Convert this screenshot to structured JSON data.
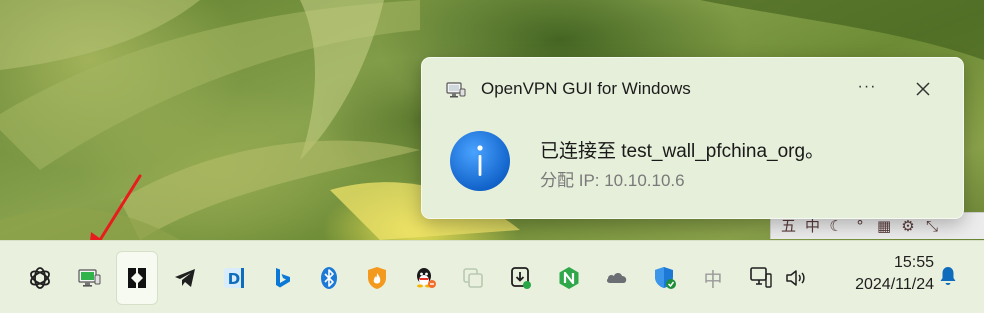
{
  "toast": {
    "app_name": "OpenVPN GUI for Windows",
    "more_label": "···",
    "message": "已连接至 test_wall_pfchina_org。",
    "sub_message": "分配 IP: 10.10.10.6",
    "app_icon": "openvpn-monitor-icon",
    "info_icon": "info-icon",
    "close_icon": "close-icon"
  },
  "ime_toolbar": {
    "items": [
      "五",
      "中",
      "☾",
      "°",
      "▦",
      "⚙",
      "⤡"
    ]
  },
  "taskbar": {
    "icons": [
      {
        "name": "chatgpt-icon"
      },
      {
        "name": "openvpn-tray-icon"
      },
      {
        "name": "app-b-icon",
        "active": true
      },
      {
        "name": "telegram-icon"
      },
      {
        "name": "dictionary-d-icon"
      },
      {
        "name": "bing-icon"
      },
      {
        "name": "bluetooth-icon"
      },
      {
        "name": "shield-flame-icon"
      },
      {
        "name": "qq-penguin-icon"
      },
      {
        "name": "copy-windows-icon"
      },
      {
        "name": "download-manager-icon"
      },
      {
        "name": "n-app-icon"
      },
      {
        "name": "onedrive-cloud-icon"
      },
      {
        "name": "windows-security-icon"
      },
      {
        "name": "ime-zhong-icon"
      },
      {
        "name": "network-icon"
      },
      {
        "name": "volume-icon"
      }
    ],
    "ime_label": "中"
  },
  "clock": {
    "time": "15:55",
    "date": "2024/11/24"
  },
  "colors": {
    "accent_blue": "#1a73d9",
    "taskbar_bg": "#e9f1de",
    "toast_bg": "#e6efd9",
    "arrow_red": "#e81c1c"
  }
}
